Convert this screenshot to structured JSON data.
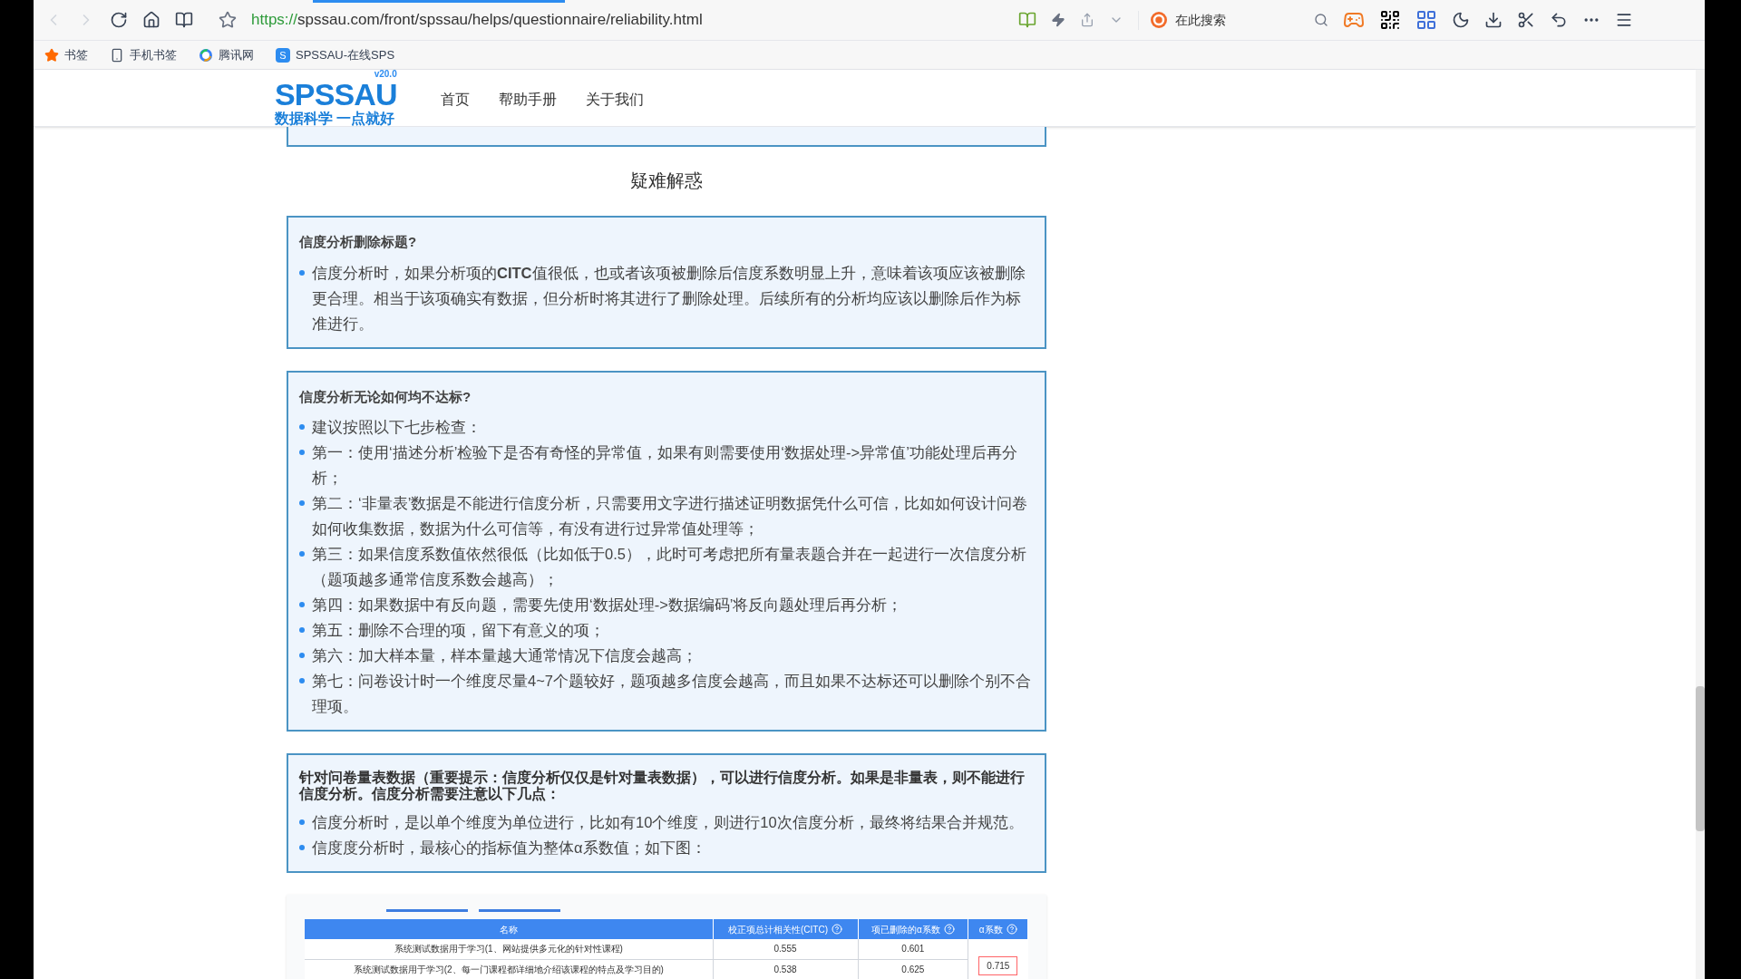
{
  "browser": {
    "url_scheme": "https://",
    "url_rest": "spssau.com/front/spssau/helps/questionnaire/reliability.html",
    "search_placeholder": "在此搜索",
    "bookmarks": [
      {
        "kind": "star",
        "label": "书签"
      },
      {
        "kind": "phone",
        "label": "手机书签"
      },
      {
        "kind": "tencent",
        "label": "腾讯网"
      },
      {
        "kind": "letter",
        "icon_letter": "S",
        "label": "SPSSAU-在线SPS"
      }
    ]
  },
  "site": {
    "logo": "SPSSAU",
    "version": "v20.0",
    "slogan": "数据科学 一点就好",
    "nav": [
      {
        "label": "首页"
      },
      {
        "label": "帮助手册"
      },
      {
        "label": "关于我们"
      }
    ]
  },
  "section_title": "疑难解惑",
  "cards": [
    {
      "title": "信度分析删除标题?",
      "title_emphasis": false,
      "items": [
        "信度分析时，如果分析项的**CITC**值很低，也或者该项被删除后信度系数明显上升，意味着该项应该被删除更合理。相当于该项确实有数据，但分析时将其进行了删除处理。后续所有的分析均应该以删除后作为标准进行。"
      ]
    },
    {
      "title": "信度分析无论如何均不达标?",
      "title_emphasis": false,
      "items": [
        "建议按照以下七步检查：",
        "第一：使用‘描述分析’检验下是否有奇怪的异常值，如果有则需要使用‘数据处理->异常值’功能处理后再分析；",
        "第二：‘非量表’数据是不能进行信度分析，只需要用文字进行描述证明数据凭什么可信，比如如何设计问卷如何收集数据，数据为什么可信等，有没有进行过异常值处理等；",
        "第三：如果信度系数值依然很低（比如低于0.5），此时可考虑把所有量表题合并在一起进行一次信度分析（题项越多通常信度系数会越高）；",
        "第四：如果数据中有反向题，需要先使用‘数据处理->数据编码’将反向题处理后再分析；",
        "第五：删除不合理的项，留下有意义的项；",
        "第六：加大样本量，样本量越大通常情况下信度会越高；",
        "第七：问卷设计时一个维度尽量4~7个题较好，题项越多信度会越高，而且如果不达标还可以删除个别不合理项。"
      ]
    },
    {
      "title": "针对问卷量表数据（重要提示：信度分析仅仅是针对量表数据），可以进行信度分析。如果是非量表，则不能进行信度分析。信度分析需要注意以下几点：",
      "title_emphasis": true,
      "items": [
        "信度分析时，是以单个维度为单位进行，比如有10个维度，则进行10次信度分析，最终将结果合并规范。",
        "信度度分析时，最核心的指标值为整体α系数值；如下图："
      ]
    }
  ],
  "table": {
    "columns": [
      "名称",
      "校正项总计相关性(CITC)",
      "项已删除的α系数",
      "α系数"
    ],
    "rows": [
      [
        "系统测试数据用于学习(1、网站提供多元化的针对性课程)",
        "0.555",
        "0.601"
      ],
      [
        "系统测试数据用于学习(2、每一门课程都详细地介绍该课程的特点及学习目的)",
        "0.538",
        "0.625"
      ]
    ],
    "alpha": "0.715"
  }
}
